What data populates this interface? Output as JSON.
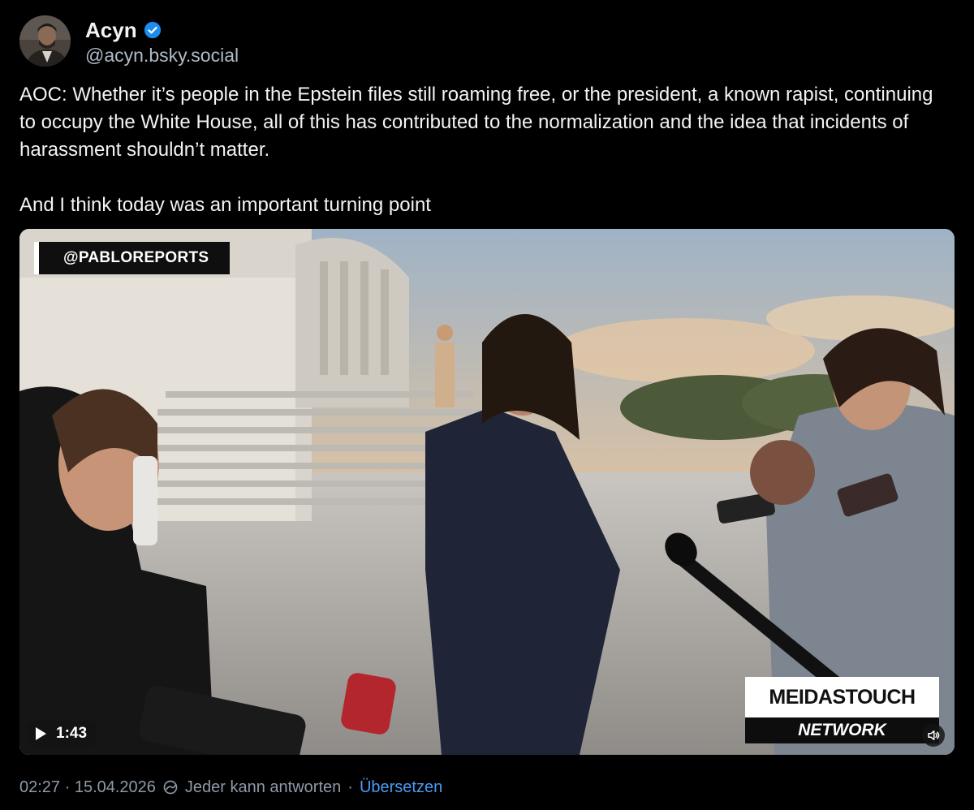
{
  "author": {
    "name": "Acyn",
    "handle": "@acyn.bsky.social",
    "verified": true,
    "avatar_icon": "profile-photo"
  },
  "post": {
    "paragraphs": [
      "AOC: Whether it’s people in the Epstein files still roaming free, or the president, a known rapist, continuing to occupy the White House, all of this has contributed to the normalization and the idea that incidents of harassment shouldn’t matter.",
      "And I think today was an important turning point"
    ]
  },
  "video": {
    "source_tag": "@PABLOREPORTS",
    "watermark_top": "MEIDASTOUCH",
    "watermark_bottom": "NETWORK",
    "duration": "1:43",
    "play_icon": "play-icon",
    "mute_icon": "speaker-muted-icon"
  },
  "meta": {
    "timestamp": "02:27 · 15.04.2026",
    "separator": "·",
    "reply_setting": "Jeder kann antworten",
    "translate_label": "Übersetzen",
    "reply_icon": "globe-reply-icon"
  },
  "colors": {
    "background": "#000000",
    "text": "#f1f3f5",
    "muted": "#8d9aa8",
    "link": "#4a9bf2",
    "verified": "#1d8cf0"
  }
}
